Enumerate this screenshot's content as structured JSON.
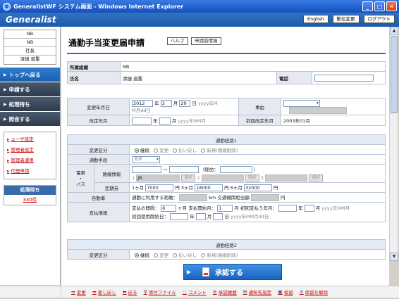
{
  "window": {
    "title": "GeneralistWF システム画面 - Windows Internet Explorer",
    "minimize": "_",
    "maximize": "□",
    "close": "✕"
  },
  "header": {
    "logo": "Generalist",
    "buttons": [
      "English",
      "勤位変更",
      "ログアウト"
    ]
  },
  "sidebar": {
    "user_rows": [
      "NB",
      "NB",
      "社長",
      "清鏈 道重"
    ],
    "nav": [
      {
        "label": "トップへ戻る",
        "active": true
      },
      {
        "label": "申請する",
        "active": false
      },
      {
        "label": "処理待ち",
        "active": false
      },
      {
        "label": "照会する",
        "active": false
      }
    ],
    "links": [
      "ユーザ設定",
      "管理者設定",
      "管理者運用",
      "代理申請"
    ],
    "pending_header": "処理待ち",
    "pending_count": "330件"
  },
  "page": {
    "title": "通勤手当変更届申請",
    "help_button": "ヘルプ",
    "prev_info_button": "申請前情報"
  },
  "applicant": {
    "org_label": "所属組織",
    "org_value": "NB",
    "name_label": "氏名",
    "name_value": "清鏈 道重",
    "phone_label": "電話",
    "phone_value": ""
  },
  "change": {
    "date_label": "変更年月日",
    "year": "2012",
    "year_unit": "年",
    "month": "3",
    "month_unit": "月",
    "day": "29",
    "day_unit": "日",
    "date_hint_1": "yyyy年M",
    "date_hint_2": "M月dd日",
    "reason_label": "事由",
    "revision_label": "改定年月",
    "rev_year_unit": "年",
    "rev_month_unit": "月",
    "rev_hint": "yyyy年MM月",
    "prev_revision_label": "前回改定年月",
    "prev_revision_value": "2003年01月"
  },
  "route1": {
    "section_title": "通勤経路1",
    "change_type_label": "変更区分",
    "change_types": [
      "継続",
      "変更",
      "払い戻し",
      "新規(路線削除)"
    ],
    "means_label": "通勤手段",
    "means_value": "電車",
    "train_label": "電車\n・\nバス",
    "route_info_label": "路線情報",
    "tilde": "〜",
    "via_label": "（経由：",
    "via_close": "）",
    "route_nums": [
      "1",
      "2",
      "3"
    ],
    "route_1_value": "JR",
    "select_button": "選択",
    "pass_label": "定期券",
    "pass_1m_prefix": "1ヶ月",
    "pass_1m": "7000",
    "pass_3m_prefix": "円 3ヶ月",
    "pass_3m": "18000",
    "pass_6m_prefix": "円 6ヶ月",
    "pass_6m": "32000",
    "pass_yen": "円",
    "car_label": "自動車",
    "car_distance_label": "通勤に利用する距離：",
    "car_distance_unit": "km",
    "car_transport_label": "交通機関相当額",
    "car_transport_unit": "円",
    "payment_label": "支払情報",
    "pay_interval_label": "支払の間隔：",
    "pay_interval": "6",
    "pay_interval_unit": "ヶ月",
    "pay_start_label": "支払開始月：",
    "pay_start": "1",
    "pay_start_unit": "月",
    "first_pay_label": "初回支払う年月：",
    "first_pay_year_unit": "年",
    "first_pay_month_unit": "月",
    "first_pay_hint": "yyyy年MM月",
    "first_use_label": "初回使用開始日：",
    "first_use_year_unit": "年",
    "first_use_month_unit": "月",
    "first_use_day_unit": "日",
    "first_use_hint": "yyyy年MM月dd日"
  },
  "route2": {
    "section_title": "通勤経路2",
    "change_type_label": "変更区分",
    "change_types": [
      "継続",
      "変更",
      "払い戻し",
      "新規(路線削除)"
    ]
  },
  "approve_button": "承認する",
  "bottom_toolbar": [
    {
      "icon": "green-arrow-icon",
      "glyph": "➡",
      "label": "変更",
      "color": "grn"
    },
    {
      "icon": "red-arrow-icon",
      "glyph": "➡",
      "label": "差し戻し",
      "color": "red"
    },
    {
      "icon": "back-arrow-icon",
      "glyph": "⬅",
      "label": "戻る",
      "color": "blk"
    },
    {
      "icon": "paperclip-icon",
      "glyph": "⚲",
      "label": "添付ファイル",
      "color": "blk"
    },
    {
      "icon": "comment-icon",
      "glyph": "◌",
      "label": "コメント",
      "color": "blu"
    },
    {
      "icon": "history-icon",
      "glyph": "≡",
      "label": "承認履歴",
      "color": "blk"
    },
    {
      "icon": "notify-icon",
      "glyph": "✉",
      "label": "通知先設定",
      "color": "blk"
    },
    {
      "icon": "save-icon",
      "glyph": "▣",
      "label": "保留",
      "color": "blu"
    },
    {
      "icon": "unsave-icon",
      "glyph": "⊘",
      "label": "保留を解除",
      "color": "blu"
    }
  ]
}
